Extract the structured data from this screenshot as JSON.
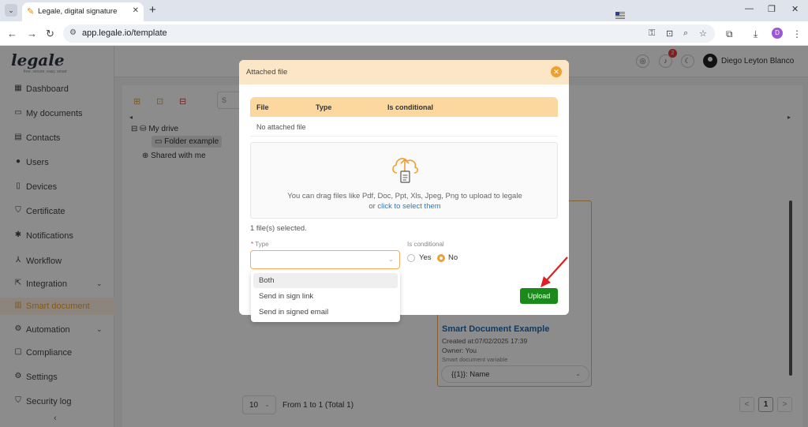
{
  "browser": {
    "tab_title": "Legale, digital signature",
    "url": "app.legale.io/template",
    "profile_initial": "D"
  },
  "app": {
    "logo": "legale",
    "logo_sub": "free. secure. easy. smart",
    "user_name": "Diego Leyton Blanco",
    "notification_count": "2"
  },
  "sidebar": {
    "items": [
      {
        "label": "Dashboard",
        "icon": "dashboard-icon"
      },
      {
        "label": "My documents",
        "icon": "folder-icon"
      },
      {
        "label": "Contacts",
        "icon": "contacts-icon"
      },
      {
        "label": "Users",
        "icon": "user-icon"
      },
      {
        "label": "Devices",
        "icon": "device-icon"
      },
      {
        "label": "Certificate",
        "icon": "shield-icon"
      },
      {
        "label": "Notifications",
        "icon": "bell-icon"
      },
      {
        "label": "Workflow",
        "icon": "workflow-icon"
      },
      {
        "label": "Integration",
        "icon": "integration-icon"
      },
      {
        "label": "Smart document",
        "icon": "smart-document-icon"
      },
      {
        "label": "Automation",
        "icon": "automation-icon"
      },
      {
        "label": "Compliance",
        "icon": "compliance-icon"
      },
      {
        "label": "Settings",
        "icon": "gear-icon"
      },
      {
        "label": "Security log",
        "icon": "security-log-icon"
      }
    ]
  },
  "tree": {
    "root": "My drive",
    "folder": "Folder example",
    "shared": "Shared with me"
  },
  "search": {
    "placeholder": "S"
  },
  "card": {
    "title": "Smart Document Example",
    "created": "Created at:07/02/2025 17:39",
    "owner": "Owner: You",
    "variable_label": "Smart document variable",
    "variable_value": "{{1}}: Name"
  },
  "pager": {
    "page_size": "10",
    "total_text": "From 1 to 1 (Total 1)",
    "current_page": "1",
    "prev": "<",
    "next": ">"
  },
  "modal": {
    "title": "Attached file",
    "table_headers": [
      "File",
      "Type",
      "Is conditional"
    ],
    "empty_text": "No attached file",
    "dropzone_text": "You can drag files like Pdf, Doc, Ppt, Xls, Jpeg, Png to upload to legale",
    "dropzone_or": "or",
    "dropzone_link": "click to select them",
    "files_selected": "1 file(s) selected.",
    "type_label": "Type",
    "type_required_mark": "*",
    "cond_label": "Is conditional",
    "radio_yes": "Yes",
    "radio_no": "No",
    "upload_label": "Upload",
    "type_options": [
      "Both",
      "Send in sign link",
      "Send in signed email"
    ]
  },
  "colors": {
    "accent": "#f0a030",
    "modal_header": "#fbe7c8",
    "table_header": "#fcd79e",
    "upload_green": "#1a8a1a",
    "link_blue": "#2a7ac6",
    "arrow_red": "#e02020"
  }
}
